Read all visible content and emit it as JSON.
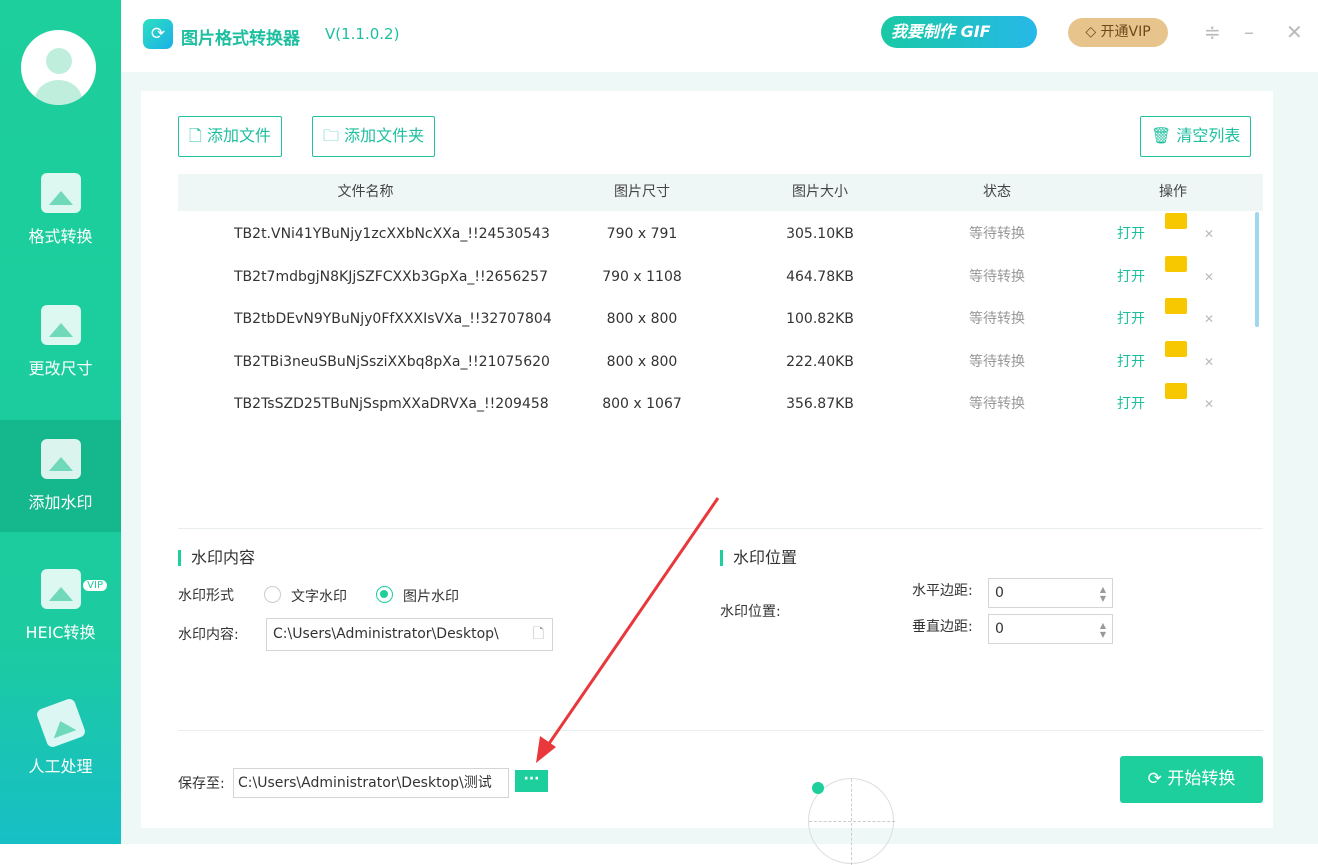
{
  "sidebar": {
    "items": [
      {
        "label": "格式转换"
      },
      {
        "label": "更改尺寸"
      },
      {
        "label": "添加水印"
      },
      {
        "label": "HEIC转换",
        "badge": "VIP"
      },
      {
        "label": "人工处理"
      }
    ],
    "active": "添加水印"
  },
  "header": {
    "title": "图片格式转换器",
    "version": "V(1.1.0.2)",
    "gif_button": "我要制作 GIF",
    "vip_button": "开通VIP"
  },
  "toolbar": {
    "add_file": "添加文件",
    "add_folder": "添加文件夹",
    "clear_list": "清空列表"
  },
  "table": {
    "columns": [
      "文件名称",
      "图片尺寸",
      "图片大小",
      "状态",
      "操作"
    ],
    "rows": [
      {
        "name": "TB2t.VNi41YBuNjy1zcXXbNcXXa_!!24530543",
        "dims": "790 x 791",
        "size": "305.10KB",
        "status": "等待转换",
        "open": "打开"
      },
      {
        "name": "TB2t7mdbgjN8KJjSZFCXXb3GpXa_!!2656257",
        "dims": "790 x 1108",
        "size": "464.78KB",
        "status": "等待转换",
        "open": "打开"
      },
      {
        "name": "TB2tbDEvN9YBuNjy0FfXXXIsVXa_!!32707804",
        "dims": "800 x 800",
        "size": "100.82KB",
        "status": "等待转换",
        "open": "打开"
      },
      {
        "name": "TB2TBi3neuSBuNjSsziXXbq8pXa_!!21075620",
        "dims": "800 x 800",
        "size": "222.40KB",
        "status": "等待转换",
        "open": "打开"
      },
      {
        "name": "TB2TsSZD25TBuNjSspmXXaDRVXa_!!209458",
        "dims": "800 x 1067",
        "size": "356.87KB",
        "status": "等待转换",
        "open": "打开"
      }
    ]
  },
  "watermark": {
    "content_title": "水印内容",
    "type_label": "水印形式",
    "type_text": "文字水印",
    "type_image": "图片水印",
    "selected": "图片水印",
    "content_label": "水印内容:",
    "content_value": "C:\\Users\\Administrator\\Desktop\\",
    "position_title": "水印位置",
    "position_label": "水印位置:",
    "h_margin_label": "水平边距:",
    "h_margin": "0",
    "v_margin_label": "垂直边距:",
    "v_margin": "0"
  },
  "footer": {
    "save_label": "保存至:",
    "save_path": "C:\\Users\\Administrator\\Desktop\\测试",
    "browse": "···",
    "start": "开始转换"
  },
  "colors": {
    "accent": "#1dcf9c",
    "annotation_arrow": "#e8383b"
  }
}
